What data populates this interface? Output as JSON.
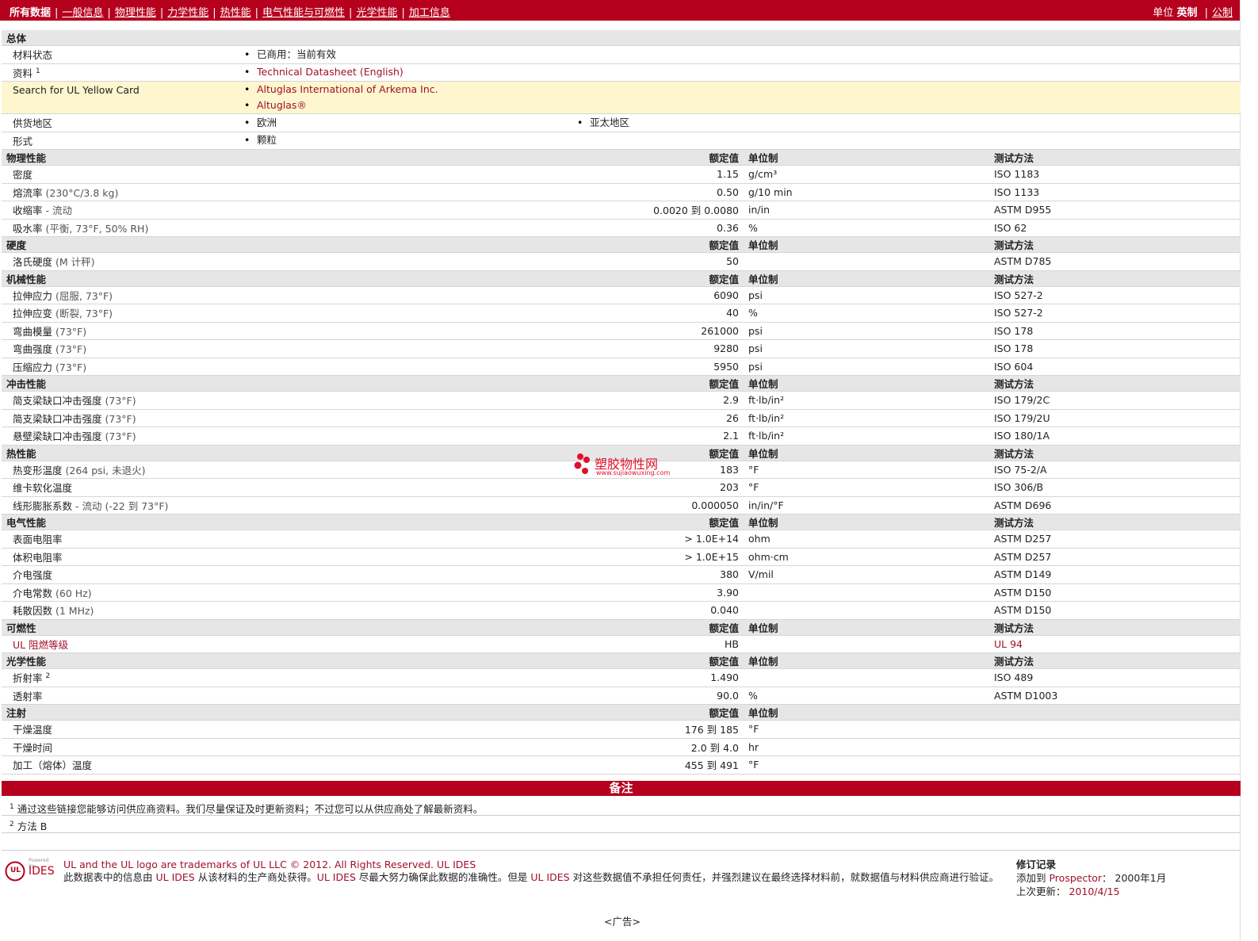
{
  "nav": {
    "items": [
      "所有数据",
      "一般信息",
      "物理性能",
      "力学性能",
      "热性能",
      "电气性能与可燃性",
      "光学性能",
      "加工信息"
    ],
    "unit_label": "单位",
    "unit_imperial": "英制",
    "unit_metric": "公制"
  },
  "general": {
    "title": "总体",
    "status_label": "材料状态",
    "status_value": "已商用：当前有效",
    "source_label": "资料",
    "source_sup": "1",
    "source_link": "Technical Datasheet (English)",
    "ul_label": "Search for UL Yellow Card",
    "ul_links": [
      "Altuglas International of Arkema Inc.",
      "Altuglas®"
    ],
    "supply_label": "供货地区",
    "supply_values": [
      "欧洲",
      "亚太地区"
    ],
    "form_label": "形式",
    "form_value": "颗粒"
  },
  "columns": {
    "nominal": "额定值",
    "unit": "单位制",
    "method": "测试方法"
  },
  "sections": [
    {
      "title": "物理性能",
      "show_method": true,
      "rows": [
        {
          "label": "密度",
          "cond": "",
          "value": "1.15",
          "unit": "g/cm³",
          "method": "ISO 1183"
        },
        {
          "label": "熔流率",
          "cond": "(230°C/3.8 kg)",
          "value": "0.50",
          "unit": "g/10 min",
          "method": "ISO 1133"
        },
        {
          "label": "收缩率",
          "cond": "- 流动",
          "value": "0.0020 到  0.0080",
          "unit": "in/in",
          "method": "ASTM D955"
        },
        {
          "label": "吸水率",
          "cond": "(平衡, 73°F, 50% RH)",
          "value": "0.36",
          "unit": "%",
          "method": "ISO 62"
        }
      ]
    },
    {
      "title": "硬度",
      "show_method": true,
      "rows": [
        {
          "label": "洛氏硬度",
          "cond": "(M 计秤)",
          "value": "50",
          "unit": "",
          "method": "ASTM D785"
        }
      ]
    },
    {
      "title": "机械性能",
      "show_method": true,
      "rows": [
        {
          "label": "拉伸应力",
          "cond": "(屈服, 73°F)",
          "value": "6090",
          "unit": "psi",
          "method": "ISO 527-2"
        },
        {
          "label": "拉伸应变",
          "cond": "(断裂, 73°F)",
          "value": "40",
          "unit": "%",
          "method": "ISO 527-2"
        },
        {
          "label": "弯曲模量",
          "cond": "(73°F)",
          "value": "261000",
          "unit": "psi",
          "method": "ISO 178"
        },
        {
          "label": "弯曲强度",
          "cond": "(73°F)",
          "value": "9280",
          "unit": "psi",
          "method": "ISO 178"
        },
        {
          "label": "压缩应力",
          "cond": "(73°F)",
          "value": "5950",
          "unit": "psi",
          "method": "ISO 604"
        }
      ]
    },
    {
      "title": "冲击性能",
      "show_method": true,
      "rows": [
        {
          "label": "简支梁缺口冲击强度",
          "cond": "(73°F)",
          "value": "2.9",
          "unit": "ft·lb/in²",
          "method": "ISO 179/2C"
        },
        {
          "label": "简支梁缺口冲击强度",
          "cond": "(73°F)",
          "value": "26",
          "unit": "ft·lb/in²",
          "method": "ISO 179/2U"
        },
        {
          "label": "悬壁梁缺口冲击强度",
          "cond": "(73°F)",
          "value": "2.1",
          "unit": "ft·lb/in²",
          "method": "ISO 180/1A"
        }
      ]
    },
    {
      "title": "热性能",
      "show_method": true,
      "rows": [
        {
          "label": "热变形温度",
          "cond": "(264 psi, 未退火)",
          "value": "183",
          "unit": "°F",
          "method": "ISO 75-2/A"
        },
        {
          "label": "维卡软化温度",
          "cond": "",
          "value": "203",
          "unit": "°F",
          "method": "ISO 306/B"
        },
        {
          "label": "线形膨胀系数",
          "cond": "- 流动  (-22 到  73°F)",
          "value": "0.000050",
          "unit": "in/in/°F",
          "method": "ASTM D696"
        }
      ]
    },
    {
      "title": "电气性能",
      "show_method": true,
      "rows": [
        {
          "label": "表面电阻率",
          "cond": "",
          "value": "> 1.0E+14",
          "unit": "ohm",
          "method": "ASTM D257"
        },
        {
          "label": "体积电阻率",
          "cond": "",
          "value": "> 1.0E+15",
          "unit": "ohm·cm",
          "method": "ASTM D257"
        },
        {
          "label": "介电强度",
          "cond": "",
          "value": "380",
          "unit": "V/mil",
          "method": "ASTM D149"
        },
        {
          "label": "介电常数",
          "cond": "(60 Hz)",
          "value": "3.90",
          "unit": "",
          "method": "ASTM D150"
        },
        {
          "label": "耗散因数",
          "cond": "(1 MHz)",
          "value": "0.040",
          "unit": "",
          "method": "ASTM D150"
        }
      ]
    },
    {
      "title": "可燃性",
      "show_method": true,
      "rows": [
        {
          "label": "UL 阻燃等级",
          "cond": "",
          "value": "HB",
          "unit": "",
          "method": "UL 94",
          "label_red": true
        }
      ]
    },
    {
      "title": "光学性能",
      "show_method": true,
      "rows": [
        {
          "label": "折射率",
          "sup": "2",
          "cond": "",
          "value": "1.490",
          "unit": "",
          "method": "ISO 489"
        },
        {
          "label": "透射率",
          "cond": "",
          "value": "90.0",
          "unit": "%",
          "method": "ASTM D1003"
        }
      ]
    },
    {
      "title": "注射",
      "show_method": false,
      "rows": [
        {
          "label": "干燥温度",
          "cond": "",
          "value": "176 到  185",
          "unit": "°F",
          "method": ""
        },
        {
          "label": "干燥时间",
          "cond": "",
          "value": "2.0 到  4.0",
          "unit": "hr",
          "method": ""
        },
        {
          "label": "加工（熔体）温度",
          "cond": "",
          "value": "455 到  491",
          "unit": "°F",
          "method": ""
        }
      ]
    }
  ],
  "notes": {
    "title": "备注",
    "items": [
      {
        "num": "1",
        "text": "通过这些链接您能够访问供应商资料。我们尽量保证及时更新资料；不过您可以从供应商处了解最新资料。"
      },
      {
        "num": "2",
        "text": "方法  B"
      }
    ]
  },
  "footer": {
    "logo_powered": "Powered by",
    "logo_ul": "UL",
    "logo_ides": "IDES",
    "trademark": "UL and the UL logo are trademarks of UL LLC © 2012. All Rights Reserved.",
    "ul_ides": "UL IDES",
    "disclaimer_1": "此数据表中的信息由 ",
    "disclaimer_ul1": "UL IDES",
    "disclaimer_2": " 从该材料的生产商处获得。",
    "disclaimer_ul2": "UL IDES",
    "disclaimer_3": " 尽最大努力确保此数据的准确性。但是 ",
    "disclaimer_ul3": "UL IDES",
    "disclaimer_4": " 对这些数据值不承担任何责任，并强烈建议在最终选择材料前，就数据值与材料供应商进行验证。",
    "rev_title": "修订记录",
    "added_label": "添加到 ",
    "added_link": "Prospector",
    "added_value": "：    2000年1月",
    "updated_label": "上次更新：",
    "updated_value": "2010/4/15",
    "ad": "<广告>"
  },
  "watermark": {
    "text": "塑胶物性网",
    "url": "www.sujiaowuxing.com"
  },
  "colors": {
    "brand": "#b5001e",
    "link": "#a0102a",
    "highlight": "#fdf6cf",
    "section_bg": "#e6e6e6"
  }
}
